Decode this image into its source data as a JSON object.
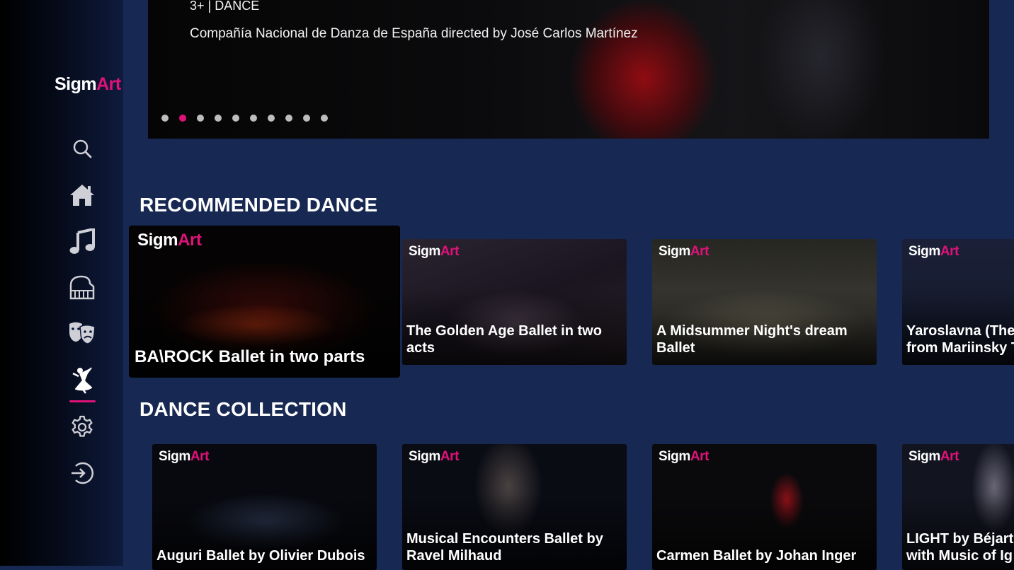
{
  "brand": {
    "logo_part1": "Sigm",
    "logo_part2": "Art",
    "accent_color": "#e0127a"
  },
  "sidebar": {
    "items": [
      {
        "icon": "search-icon",
        "label": "Search"
      },
      {
        "icon": "home-icon",
        "label": "Home"
      },
      {
        "icon": "music-note-icon",
        "label": "Music"
      },
      {
        "icon": "piano-icon",
        "label": "Opera"
      },
      {
        "icon": "theater-masks-icon",
        "label": "Theatre"
      },
      {
        "icon": "dancer-icon",
        "label": "Dance",
        "active": true
      },
      {
        "icon": "gear-icon",
        "label": "Settings"
      },
      {
        "icon": "sign-in-icon",
        "label": "Sign in"
      }
    ]
  },
  "hero": {
    "meta": "3+ | DANCE",
    "description": "Compañía Nacional de Danza de España directed by José Carlos Martínez",
    "dots_total": 10,
    "active_dot": 2
  },
  "sections": {
    "recommended": {
      "title": "RECOMMENDED DANCE",
      "cards": [
        {
          "title": "BA\\ROCK Ballet in two parts",
          "focused": true
        },
        {
          "title": "The Golden Age Ballet in two acts"
        },
        {
          "title": "A Midsummer Night's dream Ballet"
        },
        {
          "title": "Yaroslavna (The\nfrom Mariinsky T"
        }
      ]
    },
    "collection": {
      "title": "DANCE COLLECTION",
      "cards": [
        {
          "title": "Auguri Ballet by Olivier Dubois"
        },
        {
          "title": "Musical Encounters Ballet by Ravel Milhaud"
        },
        {
          "title": "Carmen Ballet by  Johan Inger"
        },
        {
          "title": "LIGHT by Béjart\nwith Music of Ig"
        }
      ]
    }
  }
}
